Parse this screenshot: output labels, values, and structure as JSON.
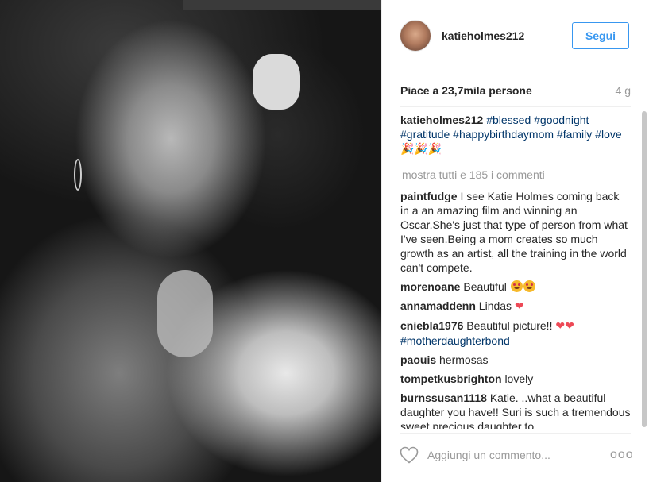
{
  "post": {
    "photo_alt": "",
    "author": "katieholmes212",
    "follow_label": "Segui",
    "likes": "Piace a 23,7mila persone",
    "age": "4 g"
  },
  "caption": {
    "author": "katieholmes212",
    "tags": [
      "#blessed",
      "#goodnight",
      "#gratitude",
      "#happybirthdaymom",
      "#family",
      "#love"
    ],
    "emoji": "🎉🎉🎉"
  },
  "comments_more": "mostra tutti e 185 i commenti",
  "comments": [
    {
      "author": "paintfudge",
      "text": "I see Katie Holmes coming back in a an amazing film and winning an Oscar.She's just that type of person from what I've seen.Being a mom creates so much growth as an artist, all the training in the world can't compete."
    },
    {
      "author": "morenoane",
      "text": "Beautiful"
    },
    {
      "author": "annamaddenn",
      "text": "Lindas"
    },
    {
      "author": "cniebla1976",
      "text": "Beautiful picture!!",
      "tag": "#motherdaughterbond"
    },
    {
      "author": "paouis",
      "text": "hermosas"
    },
    {
      "author": "tompetkusbrighton",
      "text": "lovely"
    },
    {
      "author": "burnssusan1118",
      "text": "Katie. ..what a beautiful daughter you have!! Suri is such a tremendous sweet precious daughter to"
    }
  ],
  "composer": {
    "placeholder": "Aggiungi un commento...",
    "more_glyph": "ooo"
  },
  "colors": {
    "accent": "#3897f0",
    "hashtag": "#003569",
    "muted": "#999999",
    "heart": "#ed4956"
  },
  "icons": [
    "heart-outline-icon",
    "more-options-icon",
    "heart-emoji-icon",
    "smiling-emoji-icon",
    "party-popper-emoji-icon"
  ]
}
